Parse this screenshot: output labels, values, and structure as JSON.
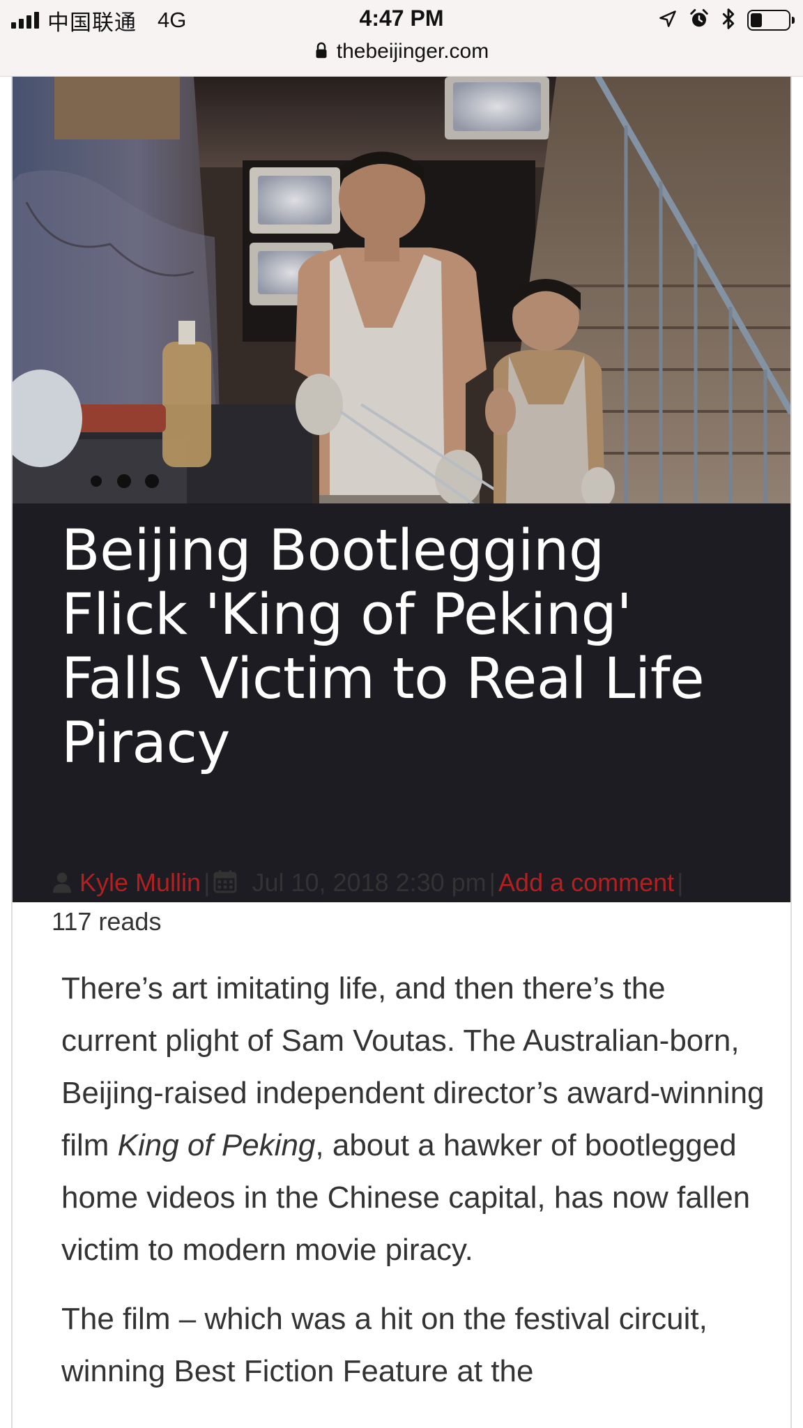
{
  "status_bar": {
    "carrier": "中国联通",
    "network": "4G",
    "time": "4:47 PM",
    "signal_bars": 4,
    "battery_level": 0.3,
    "url": "thebeijinger.com",
    "icons": [
      "location-arrow-icon",
      "alarm-icon",
      "bluetooth-icon",
      "battery-icon",
      "lock-icon"
    ]
  },
  "article": {
    "title": "Beijing Bootlegging Flick 'King of Peking' Falls Victim to Real Life Piracy",
    "hero_image_alt": "",
    "meta": {
      "author": "Kyle Mullin",
      "separator": "|",
      "date": "Jul 10, 2018 2:30 pm",
      "comment_link": "Add a comment",
      "reads": "117 reads"
    },
    "paragraph1": {
      "part1": "There’s art imitating life, and then there’s the current plight of Sam Voutas. The Australian-born, Beijing-raised independent director’s award-winning film ",
      "film_title": "King of Peking",
      "part2": ", about a hawker of bootlegged home videos in the Chinese capital, has now fallen victim to modern movie piracy."
    },
    "paragraph2": "The film – which was a hit on the festival circuit, winning Best Fiction Feature at the"
  },
  "colors": {
    "link": "#b32020",
    "title_bg": "#1c1c22",
    "title_text": "#ffffff",
    "body_text": "#333333",
    "status_bg": "#f7f3f3"
  }
}
